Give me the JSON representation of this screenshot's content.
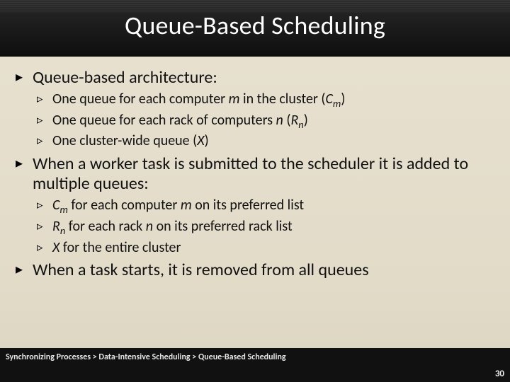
{
  "title": "Queue-Based Scheduling",
  "bullets": {
    "a": "Queue-based architecture:",
    "a1_pre": "One queue for each computer ",
    "a1_m": "m",
    "a1_mid": " in the cluster (",
    "a1_C": "C",
    "a1_sub": "m",
    "a1_post": ")",
    "a2_pre": "One queue for each rack of computers ",
    "a2_n": "n",
    "a2_mid": " (",
    "a2_R": "R",
    "a2_sub": "n",
    "a2_post": ")",
    "a3_pre": "One cluster-wide queue (",
    "a3_X": "X",
    "a3_post": ")",
    "b": "When a worker task is submitted to the scheduler it is added to multiple queues:",
    "b1_C": "C",
    "b1_sub": "m",
    "b1_mid": " for each computer ",
    "b1_m": "m",
    "b1_post": " on its preferred list",
    "b2_R": "R",
    "b2_sub": "n",
    "b2_mid": " for each rack ",
    "b2_n": "n",
    "b2_post": " on its preferred rack list",
    "b3_X": "X",
    "b3_post": " for the entire cluster",
    "c": "When a task starts, it is removed from all queues"
  },
  "breadcrumb": "Synchronizing Processes > Data-Intensive Scheduling > Queue-Based Scheduling",
  "page_number": "30"
}
